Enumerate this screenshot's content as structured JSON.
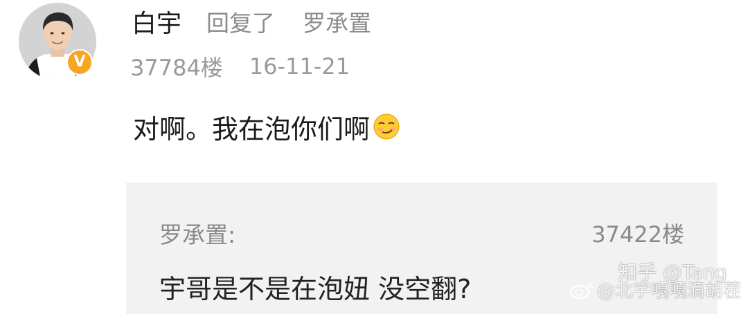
{
  "comment": {
    "username": "白宇",
    "reply_verb": "回复了",
    "reply_target": "罗承置",
    "floor": "37784楼",
    "date": "16-11-21",
    "text": "对啊。我在泡你们啊",
    "avatar_icon": "user-avatar",
    "badge_icon": "verified-v-icon",
    "badge_letter": "V",
    "emoji_icon": "smirk-emoji-icon"
  },
  "quoted": {
    "author": "罗承置:",
    "floor": "37422楼",
    "text": "宇哥是不是在泡妞 没空翻?"
  },
  "watermarks": {
    "zhihu": "知乎 @Tang",
    "weibo": "@北宇嘎嘎滴胡茬",
    "weibo_icon": "weibo-logo-icon"
  },
  "colors": {
    "badge": "#f6a623",
    "quote_background": "#f2f2f2",
    "muted_text": "#8c8c8c"
  }
}
